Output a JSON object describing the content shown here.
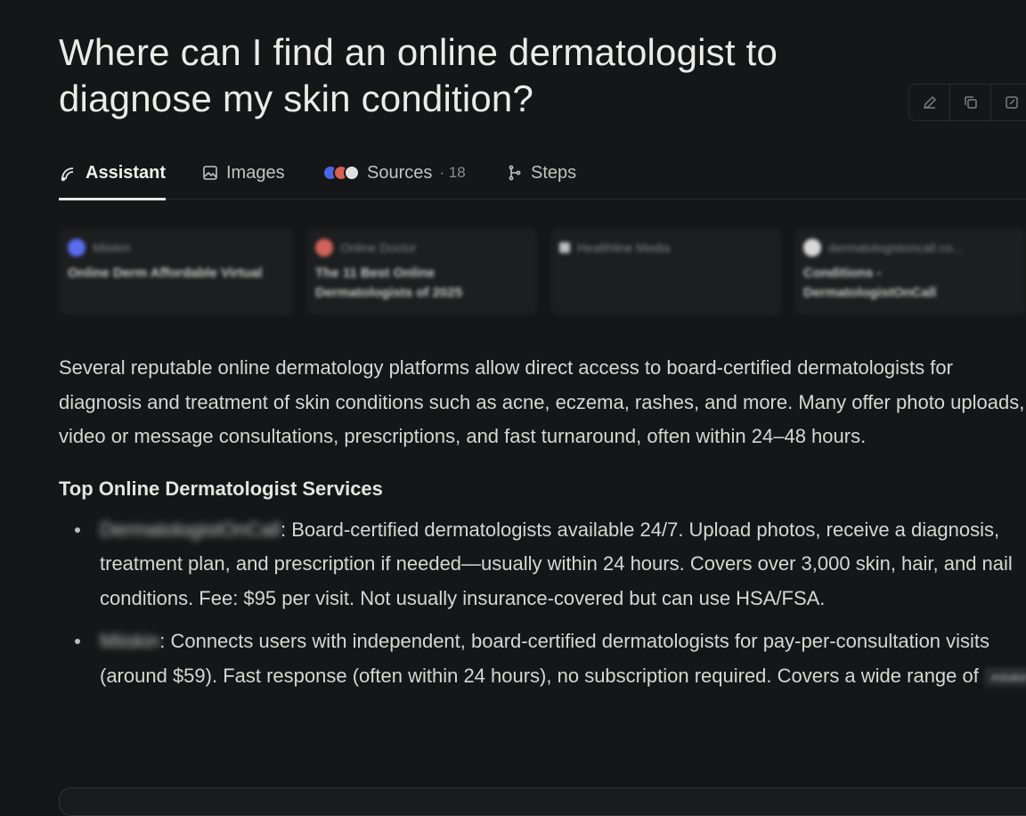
{
  "question": "Where can I find an online dermatologist to diagnose my skin condition?",
  "tabs": [
    {
      "label": "Assistant",
      "icon": "assistant-icon"
    },
    {
      "label": "Images",
      "icon": "image-icon"
    },
    {
      "label": "Sources",
      "count": "· 18",
      "icon": "source-favicons"
    },
    {
      "label": "Steps",
      "icon": "steps-icon"
    }
  ],
  "source_cards": [
    {
      "source": "Miiskin",
      "title": "Online Derm Affordable Virtual",
      "dot_color": "#5a6cf0"
    },
    {
      "source": "Online Doctor",
      "title": "The 11 Best Online Dermatologists of 2025",
      "dot_color": "#d1635a"
    },
    {
      "source": "Healthline Media",
      "title": "",
      "dot_color": "#bfbfbf"
    },
    {
      "source": "dermatologistoncall.co...",
      "title": "Conditions - DermatologistOnCall",
      "dot_color": "#d9d9d9"
    }
  ],
  "answer": {
    "intro": "Several reputable online dermatology platforms allow direct access to board-certified dermatologists for diagnosis and treatment of skin conditions such as acne, eczema, rashes, and more. Many offer photo uploads, video or message consultations, prescriptions, and fast turnaround, often within 24–48 hours.",
    "heading": "Top Online Dermatologist Services",
    "items": [
      {
        "name": "DermatologistOnCall",
        "text": ": Board-certified dermatologists available 24/7. Upload photos, receive a diagnosis, treatment plan, and prescription if needed—usually within 24 hours. Covers over 3,000 skin, hair, and nail conditions. Fee: $95 per visit. Not usually insurance-covered but can use HSA/FSA."
      },
      {
        "name": "Miiskin",
        "text": ": Connects users with independent, board-certified dermatologists for pay-per-consultation visits (around $59). Fast response (often within 24 hours), no subscription required. Covers a wide range of",
        "chip": "miiskin"
      }
    ]
  },
  "colors": {
    "background": "#151617",
    "text": "#d7d7d4",
    "title": "#ebebe8",
    "card": "#1d1e1f"
  }
}
